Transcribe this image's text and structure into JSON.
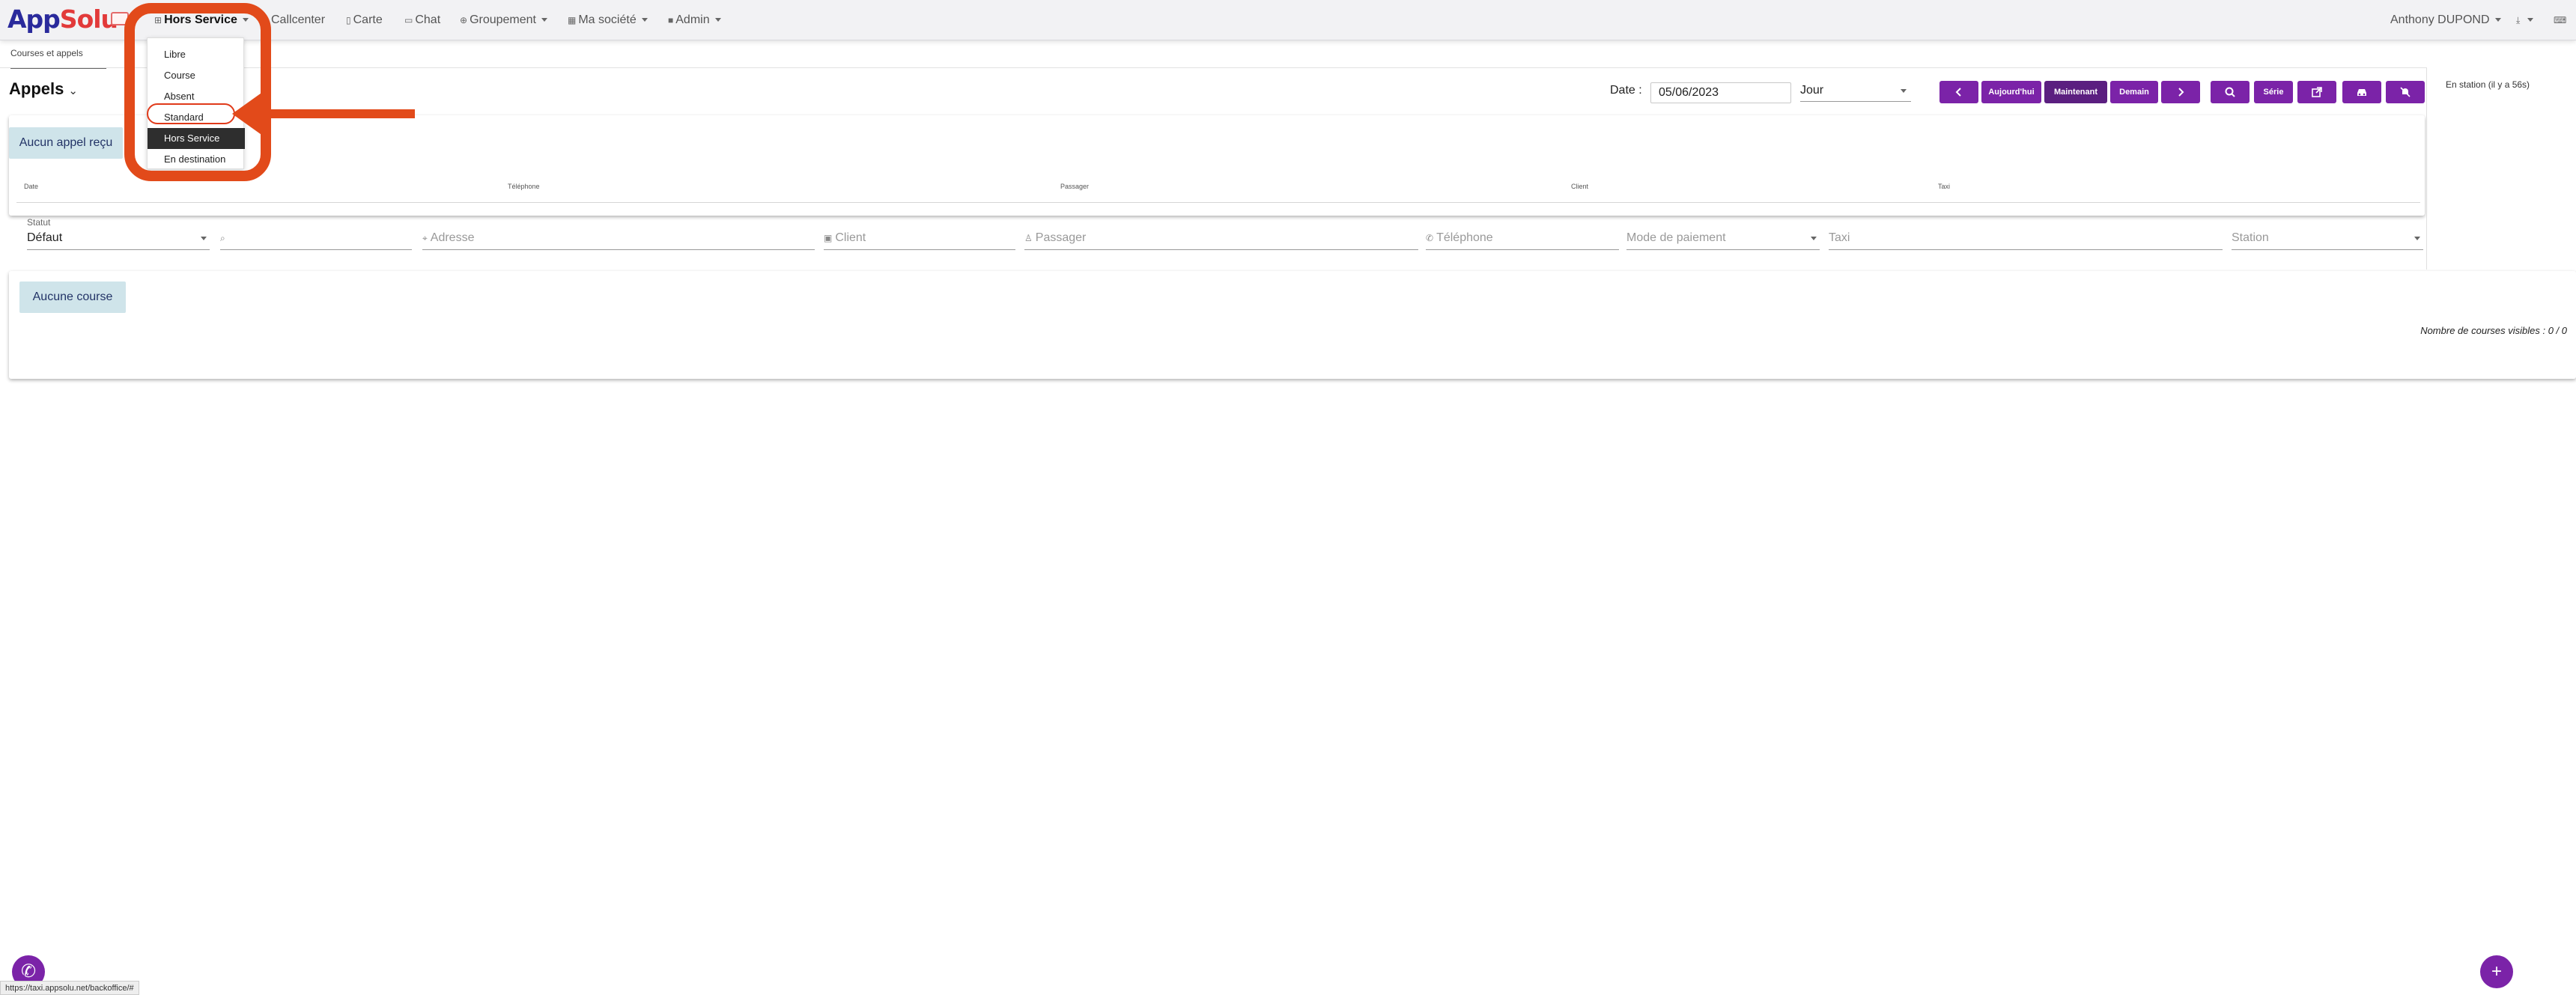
{
  "brand": {
    "logo_app": "App",
    "logo_solu": "Solu"
  },
  "nav": {
    "status_label": "Hors Service",
    "items": [
      {
        "label": "Callcenter",
        "icon": "headset-icon"
      },
      {
        "label": "Carte",
        "icon": "map-icon"
      },
      {
        "label": "Chat",
        "icon": "chat-icon"
      },
      {
        "label": "Groupement",
        "icon": "group-icon"
      },
      {
        "label": "Ma société",
        "icon": "building-icon"
      },
      {
        "label": "Admin",
        "icon": "admin-icon"
      }
    ],
    "user": "Anthony DUPOND"
  },
  "status_menu": {
    "options": [
      "Libre",
      "Course",
      "Absent",
      "Standard",
      "Hors Service",
      "En destination"
    ],
    "selected": "Hors Service",
    "highlighted": "Standard"
  },
  "tabs": {
    "active": "Courses et appels"
  },
  "calls": {
    "title": "Appels",
    "empty": "Aucun appel reçu",
    "columns": [
      "Date",
      "Téléphone",
      "Passager",
      "Client",
      "Taxi"
    ]
  },
  "toolbar": {
    "date_label": "Date :",
    "date_value": "05/06/2023",
    "period": "Jour",
    "today": "Aujourd'hui",
    "now": "Maintenant",
    "tomorrow": "Demain",
    "series": "Série"
  },
  "side": {
    "station_status": "En station (il y a 56s)"
  },
  "filters": {
    "status_label": "Statut",
    "status_value": "Défaut",
    "address": "Adresse",
    "client": "Client",
    "passenger": "Passager",
    "phone": "Téléphone",
    "payment": "Mode de paiement",
    "taxi": "Taxi",
    "station": "Station"
  },
  "courses": {
    "empty": "Aucune course",
    "count_text": "Nombre de courses visibles : 0 / 0"
  },
  "status_bar": {
    "url": "https://taxi.appsolu.net/backoffice/#"
  },
  "colors": {
    "accent": "#7b23a8",
    "annotation": "#e24a1a",
    "empty_badge": "#cfe4ea"
  }
}
